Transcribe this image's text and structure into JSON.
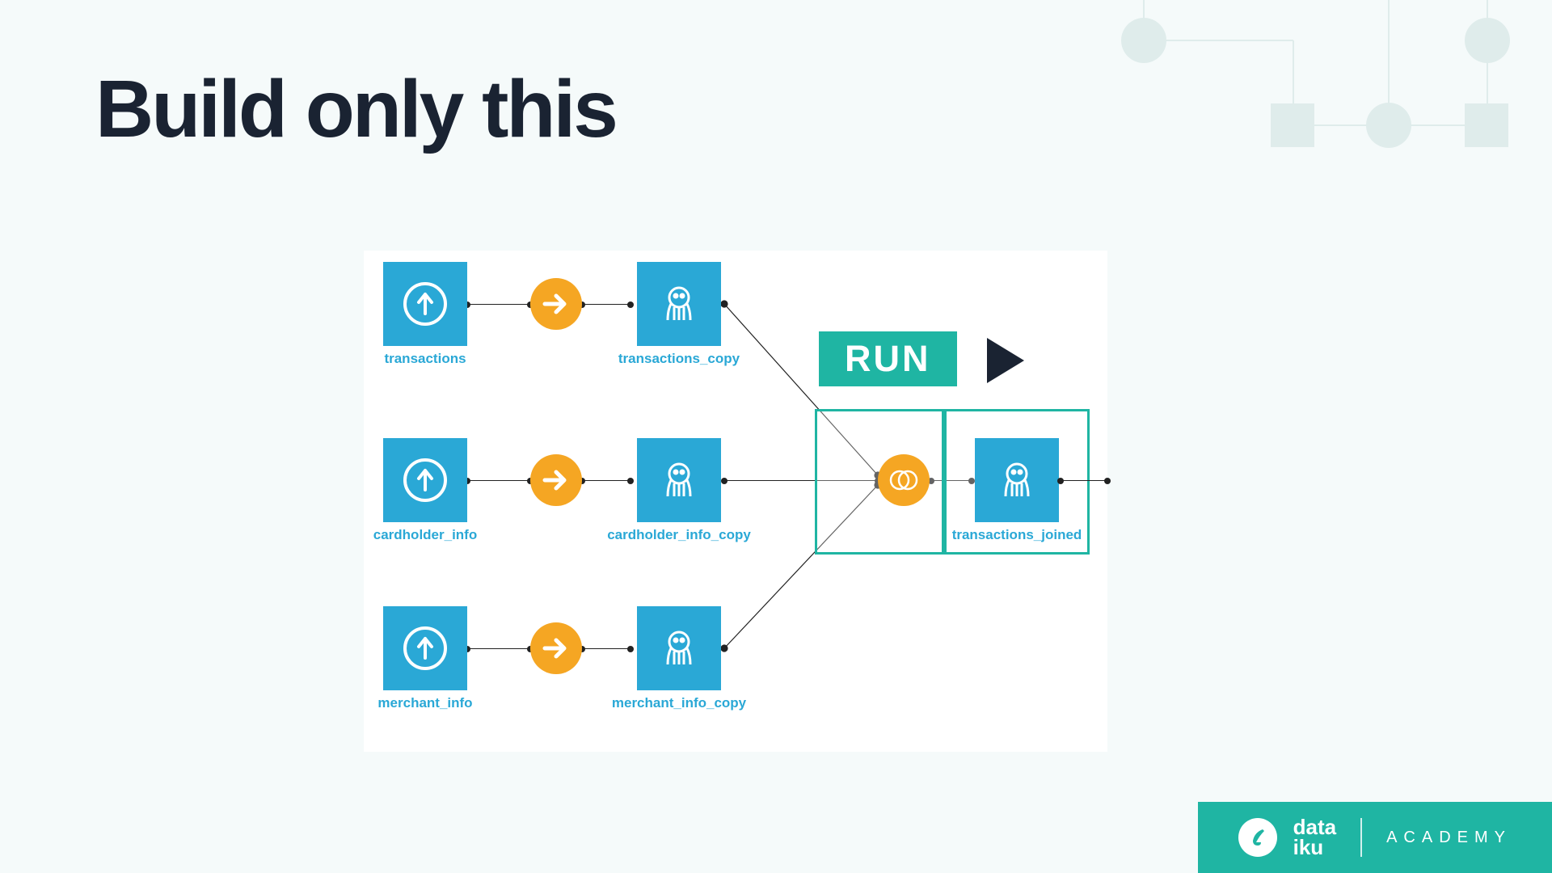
{
  "title": "Build only this",
  "nodes": {
    "n1": "transactions",
    "n1c": "transactions_copy",
    "n2": "cardholder_info",
    "n2c": "cardholder_info_copy",
    "n3": "merchant_info",
    "n3c": "merchant_info_copy",
    "out": "transactions_joined"
  },
  "buttons": {
    "run": "RUN"
  },
  "footer": {
    "brand1": "data",
    "brand2": "iku",
    "academy": "ACADEMY"
  }
}
